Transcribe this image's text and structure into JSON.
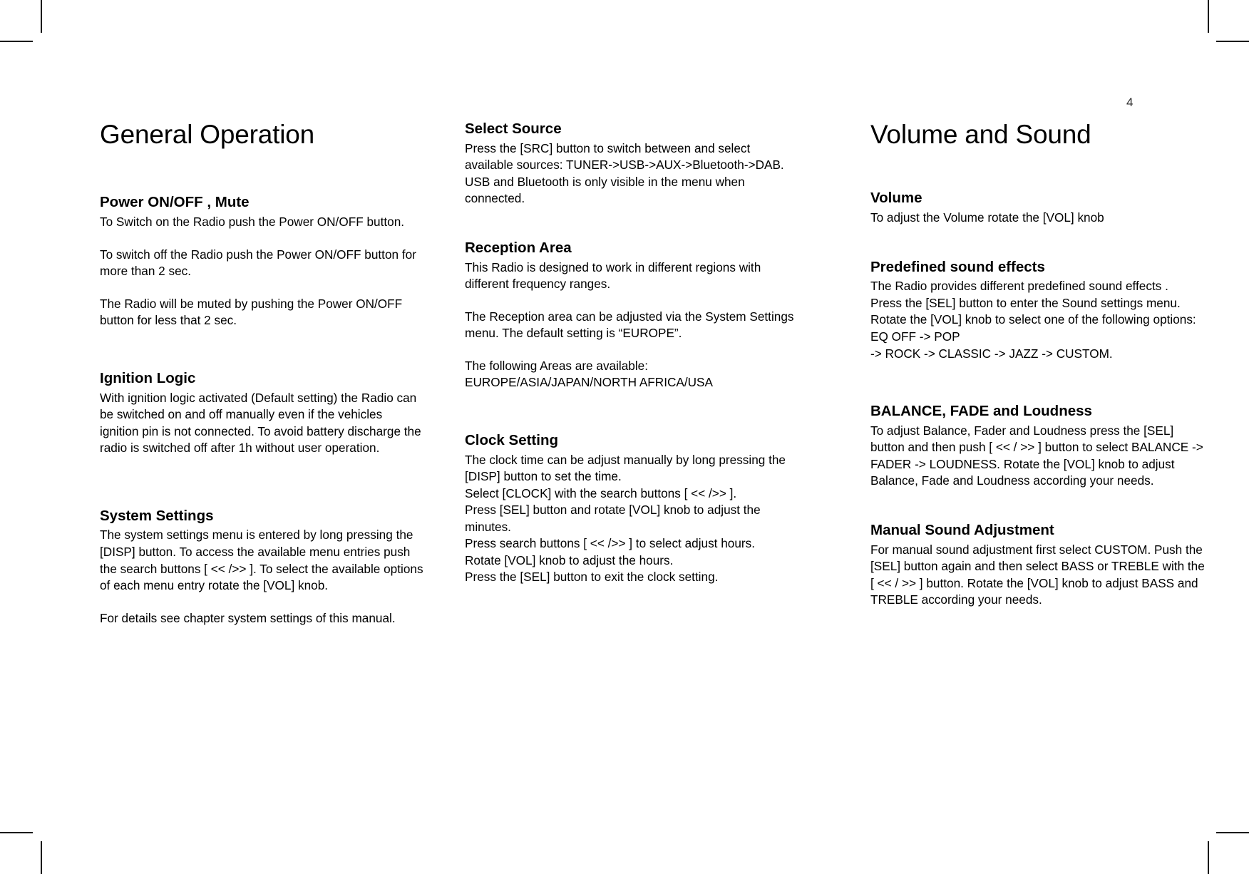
{
  "page": {
    "number": "4"
  },
  "columns": {
    "left": {
      "chapter_title": "General Operation",
      "sections": [
        {
          "title": "Power ON/OFF , Mute",
          "paragraphs": [
            "To Switch on the Radio push the Power ON/OFF button.",
            "To switch off the Radio push the Power ON/OFF button for more than 2 sec.",
            "The Radio will be muted by pushing the Power ON/OFF button for less that 2 sec."
          ]
        },
        {
          "title": "Ignition Logic",
          "paragraphs": [
            "With ignition logic activated (Default setting) the Radio can be switched on and off manually even if the vehicles ignition pin is not connected. To avoid battery discharge the radio is switched off after 1h without user operation."
          ]
        },
        {
          "title": "System Settings",
          "paragraphs": [
            "The system settings menu is entered by long pressing the [DISP] button. To access the available menu entries push the search  buttons [ << />> ]. To select the available options of each menu entry rotate the [VOL] knob.",
            "For details see chapter system settings of this manual."
          ]
        }
      ]
    },
    "middle": {
      "sections": [
        {
          "title": "Select Source",
          "paragraphs": [
            "Press the [SRC] button to switch between and select available sources: TUNER->USB->AUX->Bluetooth->DAB. USB and Bluetooth is only visible in the menu when connected."
          ]
        },
        {
          "title": "Reception Area",
          "paragraphs": [
            "This Radio is  designed to work in different regions with different frequency  ranges.",
            "The Reception area can be adjusted via the System Settings menu. The default setting is “EUROPE”.",
            "The following Areas are available: EUROPE/ASIA/JAPAN/NORTH AFRICA/USA"
          ]
        },
        {
          "title": "Clock Setting",
          "paragraphs": [
            "The clock time can be adjust manually by long pressing the [DISP] button to set the time.",
            "Select  [CLOCK]  with  the  search  buttons [ << />> ].",
            "Press [SEL] button and rotate [VOL] knob to adjust the minutes.",
            "Press search  buttons [ << />> ] to select adjust hours. Rotate [VOL] knob to adjust the hours.",
            "Press the [SEL] button to exit the clock setting."
          ]
        }
      ]
    },
    "right": {
      "chapter_title": "Volume and Sound",
      "sections": [
        {
          "title": "Volume",
          "paragraphs": [
            "To adjust the Volume rotate the [VOL] knob"
          ]
        },
        {
          "title": "Predefined sound effects",
          "paragraphs": [
            "The Radio provides different predefined sound effects .",
            "Press the [SEL] button to enter the Sound settings menu. Rotate the [VOL] knob to select one of the following options: EQ OFF -> POP",
            "-> ROCK -> CLASSIC -> JAZZ  -> CUSTOM."
          ]
        },
        {
          "title": "BALANCE, FADE and Loudness",
          "paragraphs": [
            "To adjust Balance, Fader and Loudness press the [SEL] button and then push [ << / >> ]  button to select BALANCE -> FADER -> LOUDNESS. Rotate the [VOL] knob to adjust  Balance, Fade and Loudness according your needs."
          ]
        },
        {
          "title": "Manual Sound Adjustment",
          "paragraphs": [
            "For manual sound adjustment first select CUSTOM. Push the [SEL] button again and then select BASS  or TREBLE with the [ << / >> ]  button. Rotate the [VOL] knob to adjust  BASS and TREBLE according your needs."
          ]
        }
      ]
    }
  }
}
